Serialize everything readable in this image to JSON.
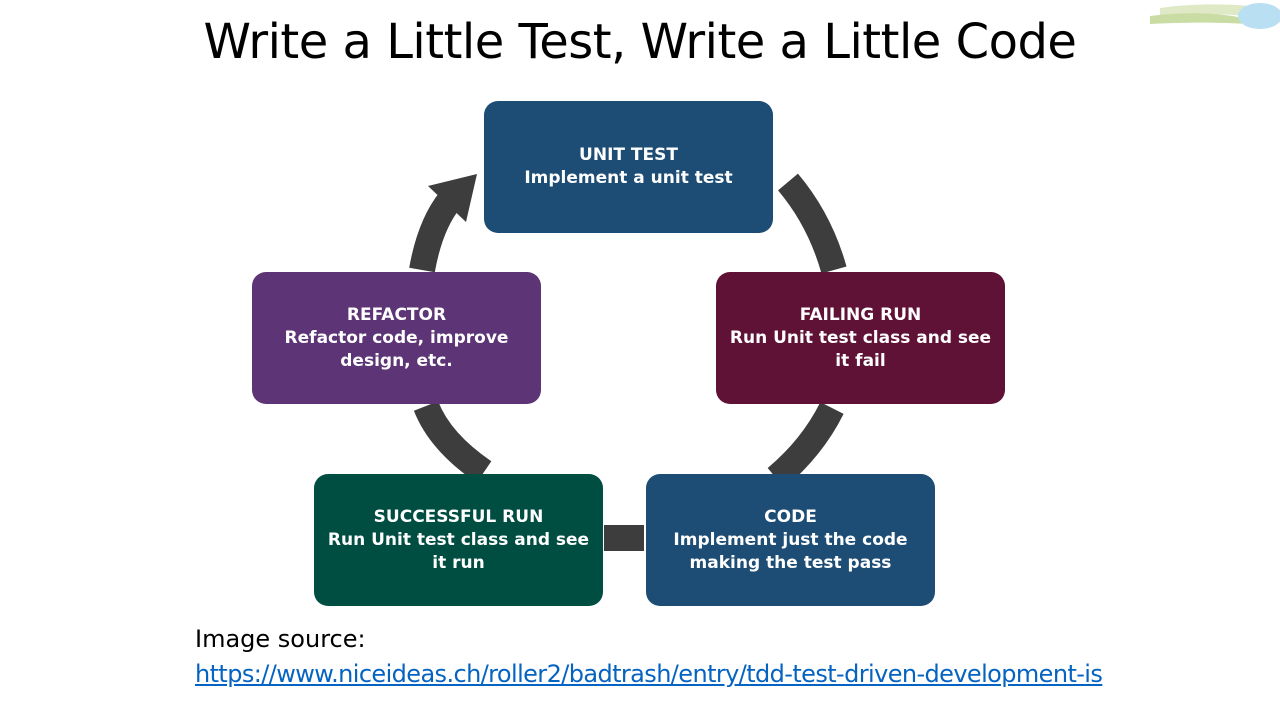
{
  "slide": {
    "title": "Write a Little Test, Write a Little Code"
  },
  "diagram": {
    "arrow_color": "#3d3d3d",
    "steps": [
      {
        "title": "UNIT TEST",
        "desc": "Implement  a unit test",
        "color": "#1d4d74"
      },
      {
        "title": "FAILING RUN",
        "desc": "Run Unit test class and see it fail",
        "color": "#5f1235"
      },
      {
        "title": "CODE",
        "desc": "Implement just the code making the test pass",
        "color": "#1d4d74"
      },
      {
        "title": "SUCCESSFUL RUN",
        "desc": "Run Unit test class and see it run",
        "color": "#004d41"
      },
      {
        "title": "REFACTOR",
        "desc": "Refactor code, improve design, etc.",
        "color": "#5d3576"
      }
    ]
  },
  "source": {
    "label": "Image source:",
    "url": "https://www.niceideas.ch/roller2/badtrash/entry/tdd-test-driven-development-is"
  }
}
